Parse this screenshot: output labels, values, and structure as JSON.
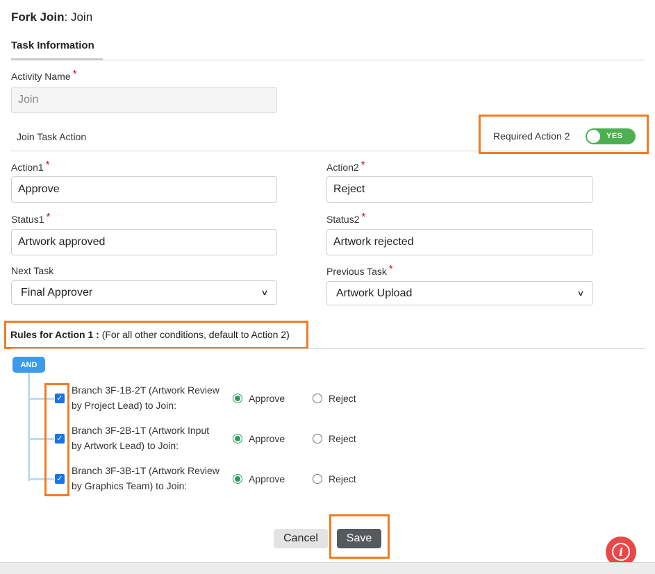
{
  "header": {
    "title_bold": "Fork Join",
    "title_rest": ": Join"
  },
  "tabs": [
    {
      "label": "Task Information"
    }
  ],
  "activity_name": {
    "label": "Activity Name",
    "required_mark": "*",
    "value": "Join"
  },
  "join_task_action": {
    "label": "Join Task Action"
  },
  "required_action": {
    "label": "Required Action 2",
    "toggle_text": "YES",
    "on": true
  },
  "action1": {
    "label": "Action1",
    "required_mark": "*",
    "value": "Approve"
  },
  "action2": {
    "label": "Action2",
    "required_mark": "*",
    "value": "Reject"
  },
  "status1": {
    "label": "Status1",
    "required_mark": "*",
    "value": "Artwork approved"
  },
  "status2": {
    "label": "Status2",
    "required_mark": "*",
    "value": "Artwork rejected"
  },
  "next_task": {
    "label": "Next Task",
    "selected": "Final Approver"
  },
  "previous_task": {
    "label": "Previous Task",
    "required_mark": "*",
    "selected": "Artwork Upload"
  },
  "rules": {
    "label_bold": "Rules for Action 1 :",
    "label_rest": " (For all other conditions, default to Action 2)",
    "operator": "AND",
    "branches": [
      {
        "line1": "Branch 3F-1B-2T (Artwork Review",
        "line2": "by Project Lead) to Join:",
        "checked": true,
        "approve": "Approve",
        "reject": "Reject",
        "selected": "Approve"
      },
      {
        "line1": "Branch 3F-2B-1T (Artwork Input",
        "line2": "by Artwork Lead) to Join:",
        "checked": true,
        "approve": "Approve",
        "reject": "Reject",
        "selected": "Approve"
      },
      {
        "line1": "Branch 3F-3B-1T (Artwork Review",
        "line2": "by Graphics Team) to Join:",
        "checked": true,
        "approve": "Approve",
        "reject": "Reject",
        "selected": "Approve"
      }
    ]
  },
  "footer": {
    "cancel_label": "Cancel",
    "save_label": "Save"
  },
  "colors": {
    "highlight": "#f47a20",
    "toggle_on": "#4caf50",
    "checkbox": "#1a73e8",
    "radio_on": "#2e9e57",
    "and_badge": "#3d9be9",
    "info_button": "#e84848"
  },
  "icons": {
    "info": "info-icon",
    "select": "chevron-down-icon",
    "check": "checkmark-icon"
  }
}
